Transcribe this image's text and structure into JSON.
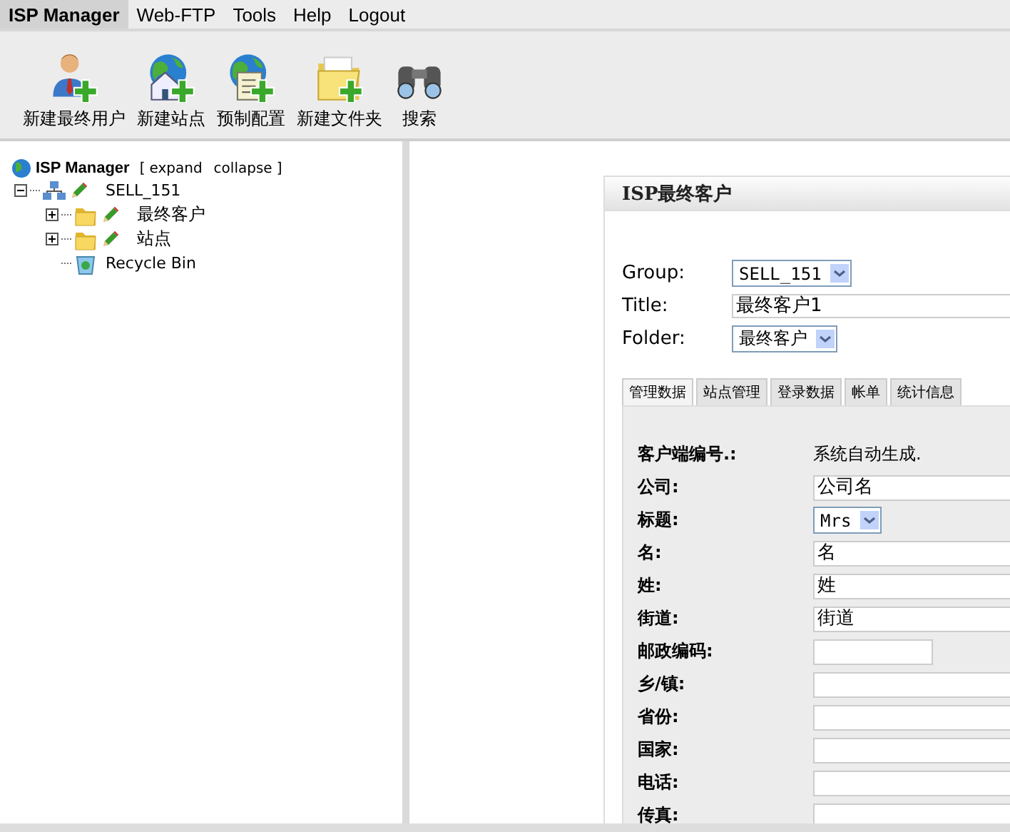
{
  "menu": [
    {
      "label": "ISP Manager",
      "selected": true
    },
    {
      "label": "Web-FTP",
      "selected": false
    },
    {
      "label": "Tools",
      "selected": false
    },
    {
      "label": "Help",
      "selected": false
    },
    {
      "label": "Logout",
      "selected": false
    }
  ],
  "toolbar": [
    {
      "kind": "user",
      "label": "新建最终用户"
    },
    {
      "kind": "site",
      "label": "新建站点"
    },
    {
      "kind": "preset",
      "label": "预制配置"
    },
    {
      "kind": "folder",
      "label": "新建文件夹"
    },
    {
      "kind": "search",
      "label": "搜索"
    }
  ],
  "tree": {
    "title": "ISP Manager",
    "expand": "expand",
    "collapse": "collapse",
    "open_bracket": "[",
    "close_bracket": "]",
    "items": [
      {
        "kind": "group",
        "label": "SELL_151",
        "expanded": true,
        "children": [
          {
            "kind": "folder",
            "label": "最终客户",
            "expanded": false
          },
          {
            "kind": "folder",
            "label": "站点",
            "expanded": false
          },
          {
            "kind": "recycle",
            "label": "Recycle Bin"
          }
        ]
      }
    ]
  },
  "panel": {
    "title": "ISP最终客户",
    "fields": [
      {
        "kind": "select",
        "label": "Group:",
        "value": "SELL_151"
      },
      {
        "kind": "text",
        "label": "Title:",
        "value": "最终客户1"
      },
      {
        "kind": "select",
        "label": "Folder:",
        "value": "最终客户"
      }
    ],
    "tabs": [
      {
        "label": "管理数据",
        "selected": true
      },
      {
        "label": "站点管理",
        "selected": false
      },
      {
        "label": "登录数据",
        "selected": false
      },
      {
        "label": "帐单",
        "selected": false
      },
      {
        "label": "统计信息",
        "selected": false
      }
    ],
    "form": [
      {
        "kind": "static",
        "label": "客户端编号.:",
        "value": "系统自动生成."
      },
      {
        "kind": "text",
        "label": "公司:",
        "value": "公司名"
      },
      {
        "kind": "select",
        "label": "标题:",
        "value": "Mrs"
      },
      {
        "kind": "text",
        "label": "名:",
        "value": "名"
      },
      {
        "kind": "text",
        "label": "姓:",
        "value": "姓"
      },
      {
        "kind": "text",
        "label": "街道:",
        "value": "街道"
      },
      {
        "kind": "short",
        "label": "邮政编码:"
      },
      {
        "kind": "text",
        "label": "乡/镇:"
      },
      {
        "kind": "text",
        "label": "省份:"
      },
      {
        "kind": "text",
        "label": "国家:"
      },
      {
        "kind": "text",
        "label": "电话:"
      },
      {
        "kind": "text",
        "label": "传真:"
      }
    ]
  }
}
